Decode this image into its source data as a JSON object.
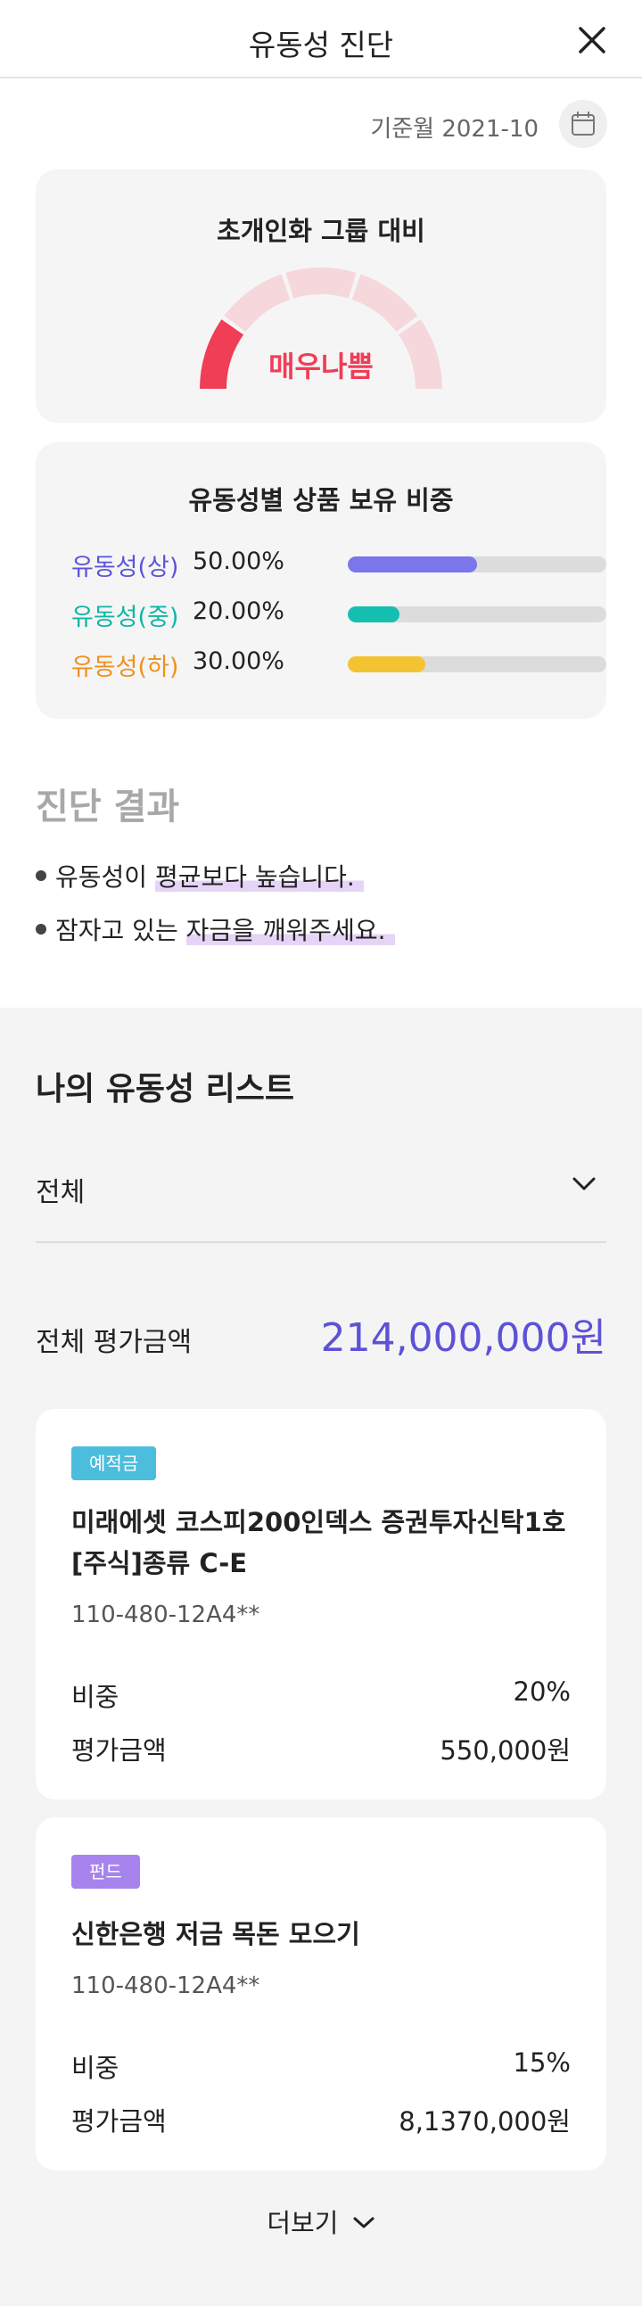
{
  "header": {
    "title": "유동성 진단",
    "close_icon": "close-icon"
  },
  "base_month": {
    "label": "기준월 2021-10",
    "icon": "calendar-icon"
  },
  "gauge": {
    "title": "초개인화 그룹 대비",
    "status": "매우나쁨",
    "level": 1,
    "levels": 5,
    "active_color": "#ef3e55",
    "inactive_color": "#f6d7dc"
  },
  "ratio": {
    "title": "유동성별 상품 보유 비중",
    "rows": [
      {
        "name": "유동성(상)",
        "pct": "50.00%",
        "value": 0.5,
        "color": "#7b76ea"
      },
      {
        "name": "유동성(중)",
        "pct": "20.00%",
        "value": 0.2,
        "color": "#15bfb0"
      },
      {
        "name": "유동성(하)",
        "pct": "30.00%",
        "value": 0.3,
        "color": "#f4c332"
      }
    ],
    "name_colors": [
      "#5b54d9",
      "#0fb6a6",
      "#f0901c"
    ]
  },
  "diagnosis": {
    "title": "진단 결과",
    "items": [
      {
        "plain": "유동성이 ",
        "highlight": "평균보다 높습니다."
      },
      {
        "plain": "잠자고 있는 ",
        "highlight": "자금을 깨워주세요."
      }
    ]
  },
  "list": {
    "title": "나의 유동성 리스트",
    "filter_value": "전체",
    "total_label": "전체 평가금액",
    "total_amount": "214,000,000원",
    "items": [
      {
        "badge": "예적금",
        "badge_color": "#4cbddd",
        "name_line1": "미래에셋 코스피200인덱스 증권투자신탁1호",
        "name_line2": "[주식]종류 C-E",
        "account": "110-480-12A4**",
        "weight_label": "비중",
        "weight_value": "20%",
        "amount_label": "평가금액",
        "amount_value": "550,000원"
      },
      {
        "badge": "펀드",
        "badge_color": "#a784ed",
        "name_line1": "신한은행 저금 목돈 모으기",
        "name_line2": "",
        "account": "110-480-12A4**",
        "weight_label": "비중",
        "weight_value": "15%",
        "amount_label": "평가금액",
        "amount_value": "8,1370,000원"
      }
    ],
    "more_label": "더보기"
  }
}
